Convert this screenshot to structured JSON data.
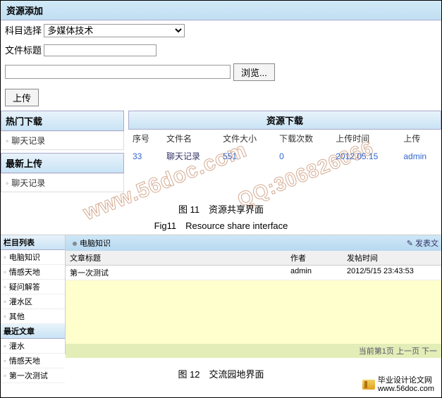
{
  "section1": {
    "title": "资源添加",
    "subject_label": "科目选择",
    "subject_value": "多媒体技术",
    "file_title_label": "文件标题",
    "file_title_value": "",
    "path_value": "",
    "browse_btn": "浏览...",
    "upload_btn": "上传"
  },
  "sidebar": {
    "hot": {
      "head": "热门下载",
      "items": [
        "聊天记录"
      ]
    },
    "new": {
      "head": "最新上传",
      "items": [
        "聊天记录"
      ]
    }
  },
  "content": {
    "head": "资源下载",
    "headers": [
      "序号",
      "文件名",
      "文件大小",
      "下载次数",
      "上传时间",
      "上传"
    ],
    "rows": [
      {
        "no": "33",
        "name": "聊天记录",
        "size": "551",
        "count": "0",
        "time": "2012.05.15",
        "up": "admin"
      }
    ]
  },
  "caption1": "图 11　资源共享界面",
  "caption2": "Fig11　Resource share interface",
  "section2": {
    "side": {
      "head1": "栏目列表",
      "items1": [
        "电脑知识",
        "情感天地",
        "疑问解答",
        "灌水区",
        "其他"
      ],
      "head2": "最近文章",
      "items2": [
        "灌水",
        "情感天地",
        "第一次测试"
      ]
    },
    "tab": "电脑知识",
    "post_link": "发表文",
    "th": {
      "title": "文章标题",
      "author": "作者",
      "time": "发帖时间"
    },
    "rows": [
      {
        "title": "第一次测试",
        "author": "admin",
        "time": "2012/5/15 23:43:53"
      }
    ],
    "footer": "当前第1页 上一页 下一"
  },
  "caption3": "图 12　交流园地界面",
  "footer_brand": {
    "line1": "毕业设计论文网",
    "line2": "www.56doc.com"
  },
  "watermark1": "www.56doc.com",
  "watermark2": "QQ:306826066"
}
